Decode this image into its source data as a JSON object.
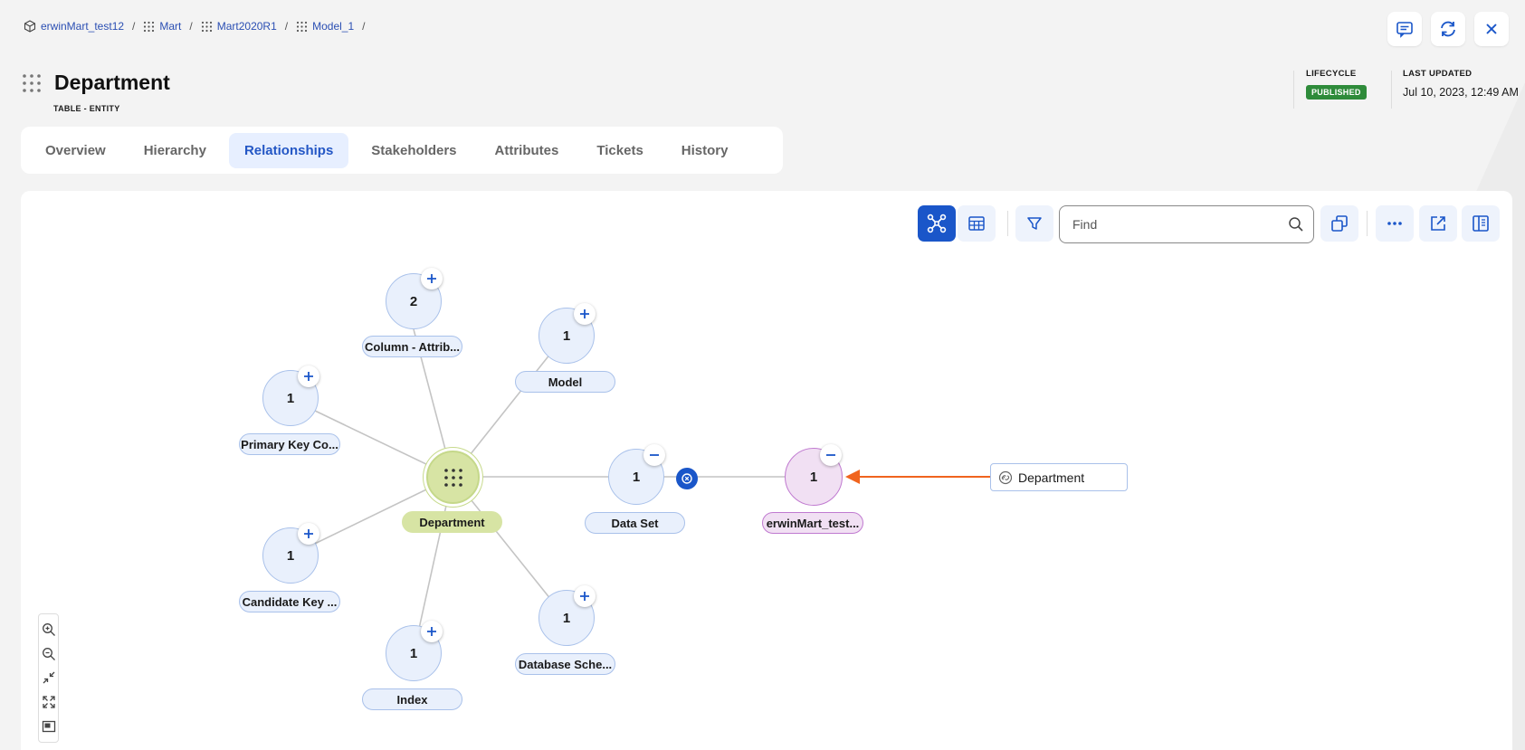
{
  "breadcrumb": [
    {
      "label": "erwinMart_test12",
      "icon": "cube-icon"
    },
    {
      "label": "Mart",
      "icon": "grid-dots-icon"
    },
    {
      "label": "Mart2020R1",
      "icon": "grid-dots-icon"
    },
    {
      "label": "Model_1",
      "icon": "grid-dots-icon"
    }
  ],
  "header": {
    "title": "Department",
    "subtitle": "TABLE - ENTITY",
    "lifecycle_label": "LIFECYCLE",
    "lifecycle_value": "PUBLISHED",
    "updated_label": "LAST UPDATED",
    "updated_value": "Jul 10, 2023, 12:49 AM"
  },
  "tabs": [
    "Overview",
    "Hierarchy",
    "Relationships",
    "Stakeholders",
    "Attributes",
    "Tickets",
    "History"
  ],
  "active_tab": "Relationships",
  "search": {
    "placeholder": "Find"
  },
  "graph": {
    "center": {
      "label": "Department"
    },
    "nodes": [
      {
        "id": "column-attrib",
        "count": "2",
        "label": "Column - Attrib..."
      },
      {
        "id": "model",
        "count": "1",
        "label": "Model"
      },
      {
        "id": "primary-key",
        "count": "1",
        "label": "Primary Key Co..."
      },
      {
        "id": "data-set",
        "count": "1",
        "label": "Data Set"
      },
      {
        "id": "erwinmart",
        "count": "1",
        "label": "erwinMart_test..."
      },
      {
        "id": "candidate-key",
        "count": "1",
        "label": "Candidate Key ..."
      },
      {
        "id": "database-schema",
        "count": "1",
        "label": "Database Sche..."
      },
      {
        "id": "index",
        "count": "1",
        "label": "Index"
      }
    ],
    "linked_item": "Department"
  },
  "colors": {
    "accent": "#1a56c9",
    "published": "#2e8b3a",
    "arrow": "#f0641e",
    "center_node": "#d7e4a4",
    "purple_node": "#f1e0f3"
  }
}
